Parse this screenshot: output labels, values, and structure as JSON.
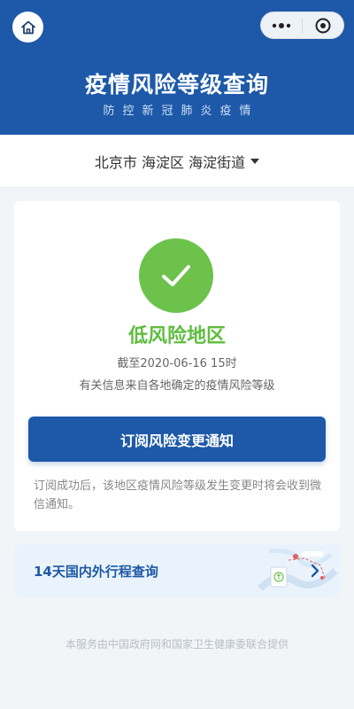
{
  "nav": {
    "home_icon": "home-icon",
    "more_icon": "more-dots-icon",
    "close_icon": "target-circle-icon"
  },
  "header": {
    "title": "疫情风险等级查询",
    "subtitle": "防控新冠肺炎疫情",
    "background": "#1d59a8"
  },
  "location": {
    "text": "北京市 海淀区 海淀街道",
    "caret_icon": "caret-down-icon"
  },
  "status": {
    "icon": "check-icon",
    "level": "低风险地区",
    "level_color": "#5fbd3f",
    "as_of": "截至2020-06-16 15时",
    "source": "有关信息来自各地确定的疫情风险等级"
  },
  "subscribe": {
    "button_label": "订阅风险变更通知",
    "note": "订阅成功后，该地区疫情风险等级发生变更时将会收到微信通知。"
  },
  "travel": {
    "label": "14天国内外行程查询",
    "chevron_icon": "chevron-right-icon"
  },
  "footer": {
    "text": "本服务由中国政府网和国家卫生健康委联合提供"
  }
}
